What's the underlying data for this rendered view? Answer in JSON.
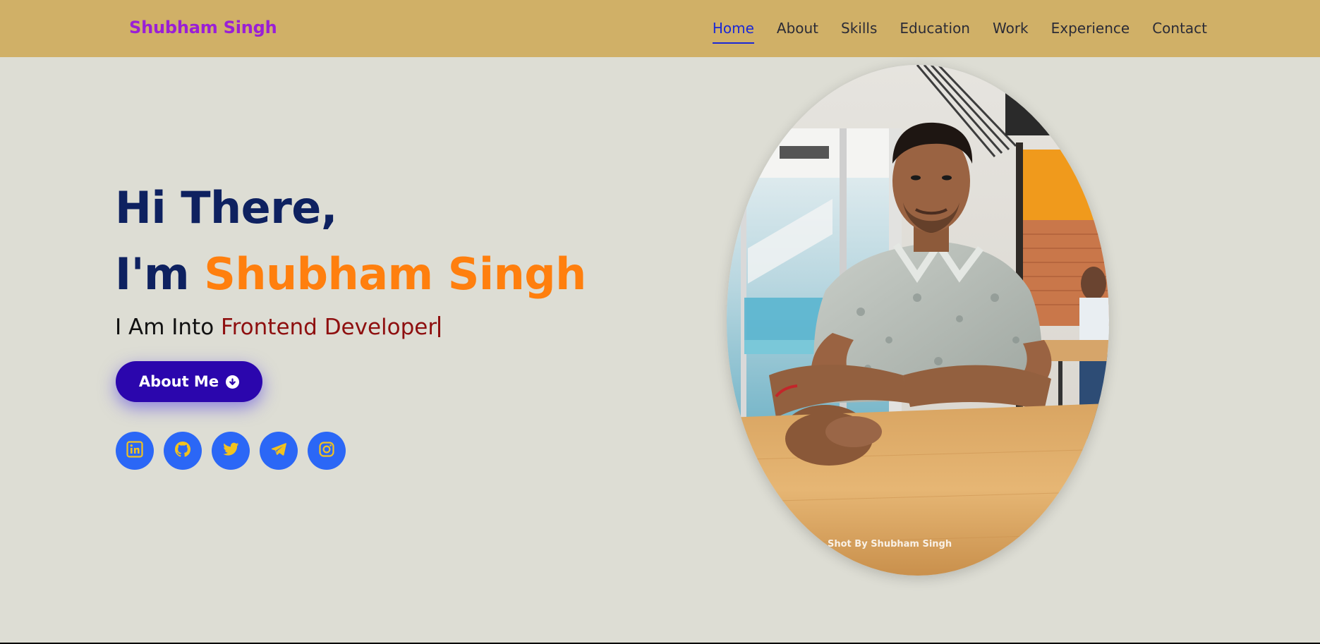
{
  "header": {
    "brand": "Shubham Singh",
    "nav": [
      {
        "label": "Home",
        "active": true
      },
      {
        "label": "About"
      },
      {
        "label": "Skills"
      },
      {
        "label": "Education"
      },
      {
        "label": "Work"
      },
      {
        "label": "Experience"
      },
      {
        "label": "Contact"
      }
    ]
  },
  "hero": {
    "greeting": "Hi There,",
    "intro_prefix": "I'm",
    "name": "Shubham Singh",
    "role_prefix": "I Am Into",
    "role_value": "Frontend Developer",
    "button_label": "About Me",
    "button_icon": "arrow-circle-down-icon"
  },
  "socials": [
    {
      "name": "linkedin",
      "icon": "linkedin-icon"
    },
    {
      "name": "github",
      "icon": "github-icon"
    },
    {
      "name": "twitter",
      "icon": "twitter-icon"
    },
    {
      "name": "telegram",
      "icon": "telegram-icon"
    },
    {
      "name": "instagram",
      "icon": "instagram-icon"
    }
  ],
  "photo": {
    "watermark": "Shot By Shubham Singh"
  },
  "colors": {
    "header_bg": "#d0b067",
    "page_bg": "#ddddd4",
    "brand": "#9a1fd6",
    "nav_active": "#1a28d6",
    "title": "#0e2160",
    "name_highlight": "#ff7f0e",
    "role_value": "#8e0f0f",
    "button_bg": "#2b06ad",
    "social_bg": "#2b67f6",
    "social_icon": "#f2c21f"
  }
}
